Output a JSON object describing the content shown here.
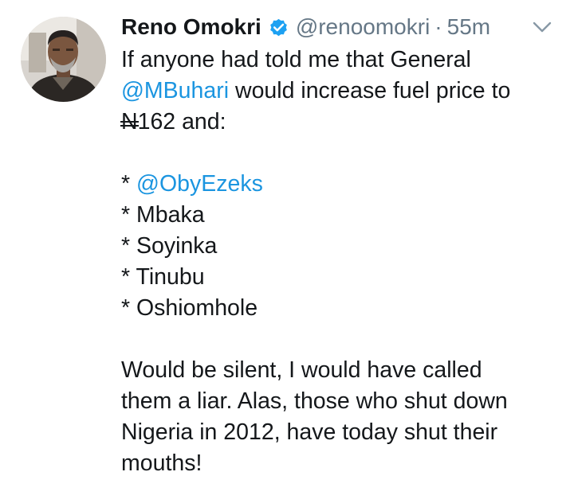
{
  "tweet": {
    "display_name": "Reno Omokri",
    "handle": "@renoomokri",
    "separator": "·",
    "time": "55m",
    "avatar_icon": "user-avatar-photo",
    "verified_icon": "verified-badge-icon",
    "more_icon": "chevron-down-icon",
    "colors": {
      "text": "#14171a",
      "muted": "#657786",
      "link": "#1b95e0",
      "verified": "#1da1f2"
    },
    "text": {
      "line1": "If anyone had told me that General",
      "line2_mention": "@MBuhari",
      "line2_rest": " would increase fuel price to",
      "line3_currency": "N",
      "line3_rest": "162 and:",
      "list_bullet": "* ",
      "list_mention": "@ObyEzeks",
      "list_items": [
        "Mbaka",
        "Soyinka",
        "Tinubu",
        "Oshiomhole"
      ],
      "closing_lines": [
        "Would be silent, I would have called",
        "them a liar. Alas, those who shut down",
        "Nigeria in 2012, have today shut their",
        "mouths!"
      ]
    }
  }
}
